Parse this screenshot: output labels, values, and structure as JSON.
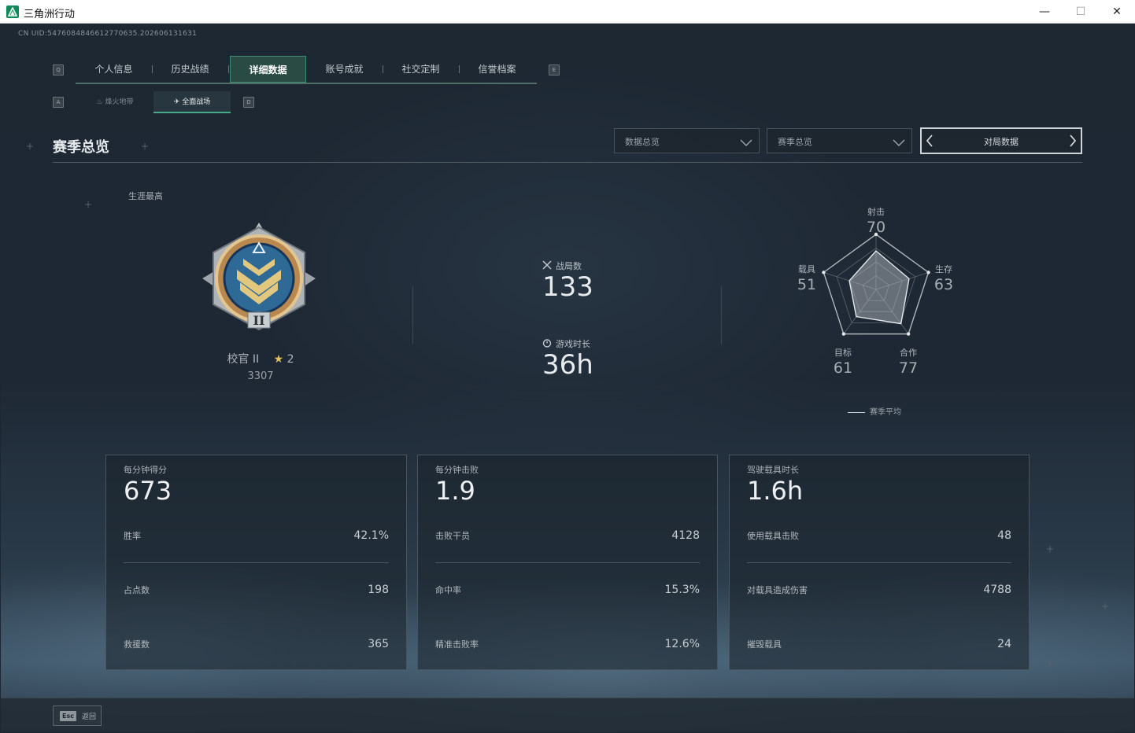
{
  "window": {
    "title": "三角洲行动",
    "minimize": "—",
    "maximize": "☐",
    "close": "✕"
  },
  "uid": "CN UID:5476084846612770635.202606131631",
  "key_hints": {
    "q": "Q",
    "e": "E",
    "a": "A",
    "d": "D"
  },
  "tabs": [
    {
      "label": "个人信息",
      "active": false
    },
    {
      "label": "历史战绩",
      "active": false
    },
    {
      "label": "详细数据",
      "active": true
    },
    {
      "label": "账号成就",
      "active": false
    },
    {
      "label": "社交定制",
      "active": false
    },
    {
      "label": "信誉档案",
      "active": false
    }
  ],
  "subtabs": [
    {
      "label": "烽火地带",
      "icon": "flame-icon",
      "active": false
    },
    {
      "label": "全面战场",
      "icon": "battlefield-icon",
      "active": true
    }
  ],
  "section_title": "赛季总览",
  "filters": {
    "data_overview": "数据总览",
    "season_overview": "赛季总览",
    "match_data": "对局数据"
  },
  "career": {
    "label": "生涯最高",
    "rank": "校官 II",
    "stars": "2",
    "points": "3307"
  },
  "summary": {
    "matches_label": "战局数",
    "matches_value": "133",
    "playtime_label": "游戏时长",
    "playtime_value": "36h"
  },
  "radar": {
    "axes": [
      {
        "label": "射击",
        "value": 70
      },
      {
        "label": "生存",
        "value": 63
      },
      {
        "label": "合作",
        "value": 77
      },
      {
        "label": "目标",
        "value": 61
      },
      {
        "label": "载具",
        "value": 51
      }
    ],
    "legend": "赛季平均"
  },
  "cards": [
    {
      "title": "每分钟得分",
      "value": "673",
      "rows": [
        {
          "label": "胜率",
          "value": "42.1%"
        },
        {
          "label": "占点数",
          "value": "198"
        },
        {
          "label": "救援数",
          "value": "365"
        }
      ]
    },
    {
      "title": "每分钟击败",
      "value": "1.9",
      "rows": [
        {
          "label": "击败干员",
          "value": "4128"
        },
        {
          "label": "命中率",
          "value": "15.3%"
        },
        {
          "label": "精准击败率",
          "value": "12.6%"
        }
      ]
    },
    {
      "title": "驾驶载具时长",
      "value": "1.6h",
      "rows": [
        {
          "label": "使用载具击败",
          "value": "48"
        },
        {
          "label": "对载具造成伤害",
          "value": "4788"
        },
        {
          "label": "摧毁载具",
          "value": "24"
        }
      ]
    }
  ],
  "footer": {
    "esc_key": "Esc",
    "back": "返回"
  },
  "colors": {
    "accent": "#3f8a72",
    "tab_active_bg": "#2a4a44",
    "rank_star": "#e2c25b"
  }
}
